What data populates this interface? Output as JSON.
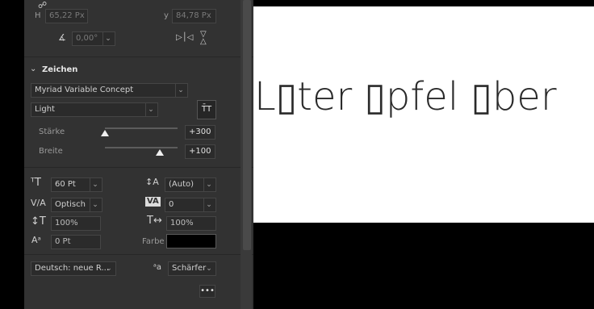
{
  "canvas": {
    "text": "L▯ter ▯pfel ▯ber"
  },
  "transform": {
    "h_label": "H",
    "h_value": "65,22 Px",
    "y_label": "y",
    "y_value": "84,78 Px",
    "angle_value": "0,00°"
  },
  "section": {
    "title": "Zeichen"
  },
  "font": {
    "family": "Myriad Variable Concept",
    "style": "Light"
  },
  "axes": [
    {
      "label": "Stärke",
      "value": "+300",
      "fraction": 0.0
    },
    {
      "label": "Breite",
      "value": "+100",
      "fraction": 0.75
    }
  ],
  "metrics": {
    "size": "60 Pt",
    "leading": "(Auto)",
    "kerning": "Optisch",
    "tracking": "0",
    "vscale": "100%",
    "hscale": "100%",
    "baseline": "0 Pt",
    "color_label": "Farbe",
    "color": "#000000"
  },
  "language": {
    "value": "Deutsch: neue R...",
    "aa_icon": "a",
    "aa_value": "Schärfer"
  },
  "more": "•••"
}
